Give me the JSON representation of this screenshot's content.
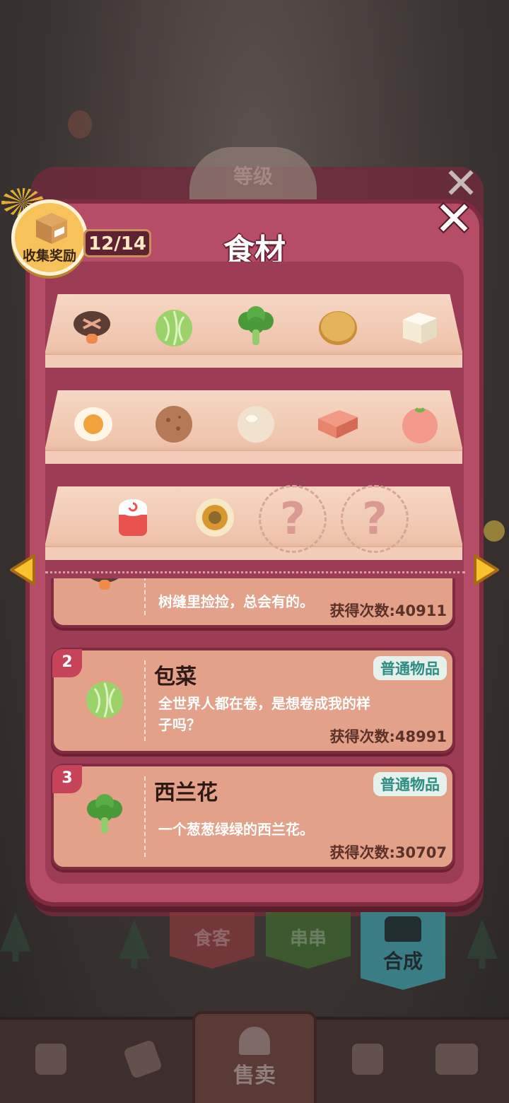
{
  "behind": {
    "level_label": "等级",
    "tabs": [
      {
        "label": "食客",
        "color": "#8a3a3c"
      },
      {
        "label": "串串",
        "color": "#3e6a2e"
      }
    ],
    "compose_label": "合成"
  },
  "bottom_nav": {
    "sell_label": "售卖",
    "items": [
      "shop-bag-icon",
      "ticket-icon",
      "map-icon",
      "bus-icon"
    ]
  },
  "dialog": {
    "title": "食材",
    "reward_label": "收集奖励",
    "progress": "12/14",
    "close_symbol": "✕"
  },
  "shelves": [
    {
      "items": [
        {
          "name": "mushroom-icon",
          "color": "#5b3d36"
        },
        {
          "name": "cabbage-icon",
          "color": "#9bd36a"
        },
        {
          "name": "broccoli-icon",
          "color": "#4a9a3a"
        },
        {
          "name": "potato-slice-icon",
          "color": "#e5b35a"
        },
        {
          "name": "tofu-icon",
          "color": "#f5ecd7"
        }
      ]
    },
    {
      "items": [
        {
          "name": "egg-icon",
          "color": "#f2a23a"
        },
        {
          "name": "meatball-icon",
          "color": "#b57a55"
        },
        {
          "name": "fishball-icon",
          "color": "#f0e2cf"
        },
        {
          "name": "luncheon-meat-icon",
          "color": "#e8836c"
        },
        {
          "name": "shrimp-ball-icon",
          "color": "#f39a8a"
        }
      ]
    },
    {
      "items": [
        {
          "name": "fishcake-roll-icon",
          "color": "#e8534f"
        },
        {
          "name": "egg-roll-icon",
          "color": "#d9982f"
        },
        {
          "name": "unknown",
          "label": "?"
        },
        {
          "name": "unknown",
          "label": "?"
        }
      ]
    }
  ],
  "list": [
    {
      "number": "",
      "name": "",
      "tag": "",
      "desc": "树缝里捡捡，总会有的。",
      "count": "获得次数:40911"
    },
    {
      "number": "2",
      "name": "包菜",
      "tag": "普通物品",
      "desc": "全世界人都在卷，是想卷成我的样子吗？",
      "count": "获得次数:48991"
    },
    {
      "number": "3",
      "name": "西兰花",
      "tag": "普通物品",
      "desc": "一个葱葱绿绿的西兰花。",
      "count": "获得次数:30707"
    }
  ]
}
